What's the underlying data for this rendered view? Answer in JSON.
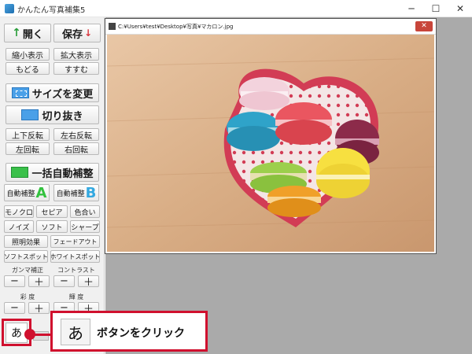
{
  "window": {
    "title": "かんたん写真補集5",
    "min_label": "─",
    "max_label": "☐",
    "close_label": "✕"
  },
  "sidebar": {
    "open_label": "開く",
    "save_label": "保存",
    "shrink_label": "縮小表示",
    "enlarge_label": "拡大表示",
    "undo_label": "もどる",
    "redo_label": "すすむ",
    "resize_label": "サイズを変更",
    "crop_label": "切り抜き",
    "flip_v_label": "上下反転",
    "flip_h_label": "左右反転",
    "rotate_left_label": "左回転",
    "rotate_right_label": "右回転",
    "bulk_auto_label": "一括自動補整",
    "auto_a_label": "自動補整",
    "auto_a_letter": "A",
    "auto_b_label": "自動補整",
    "auto_b_letter": "B",
    "mono_label": "モノクロ",
    "sepia_label": "セピア",
    "tint_label": "色合い",
    "noise_label": "ノイズ",
    "soft_label": "ソフト",
    "sharp_label": "シャープ",
    "lighting_label": "照明効果",
    "fade_label": "フェードアウト",
    "soft_spot_label": "ソフトスポット",
    "white_spot_label": "ホワイトスポット",
    "gamma_label": "ガンマ補正",
    "contrast_label": "コントラスト",
    "saturation_label": "彩 度",
    "brightness_label": "輝 度",
    "minus_label": "−",
    "plus_label": "＋",
    "a_button_label": "あ"
  },
  "image_window": {
    "title": "C:¥Users¥test¥Desktop¥写真¥マカロン.jpg",
    "close_label": "✕"
  },
  "callout": {
    "icon_label": "あ",
    "text": "ボタンをクリック"
  },
  "colors": {
    "highlight": "#d0102e",
    "workspace": "#aaaaaa"
  }
}
